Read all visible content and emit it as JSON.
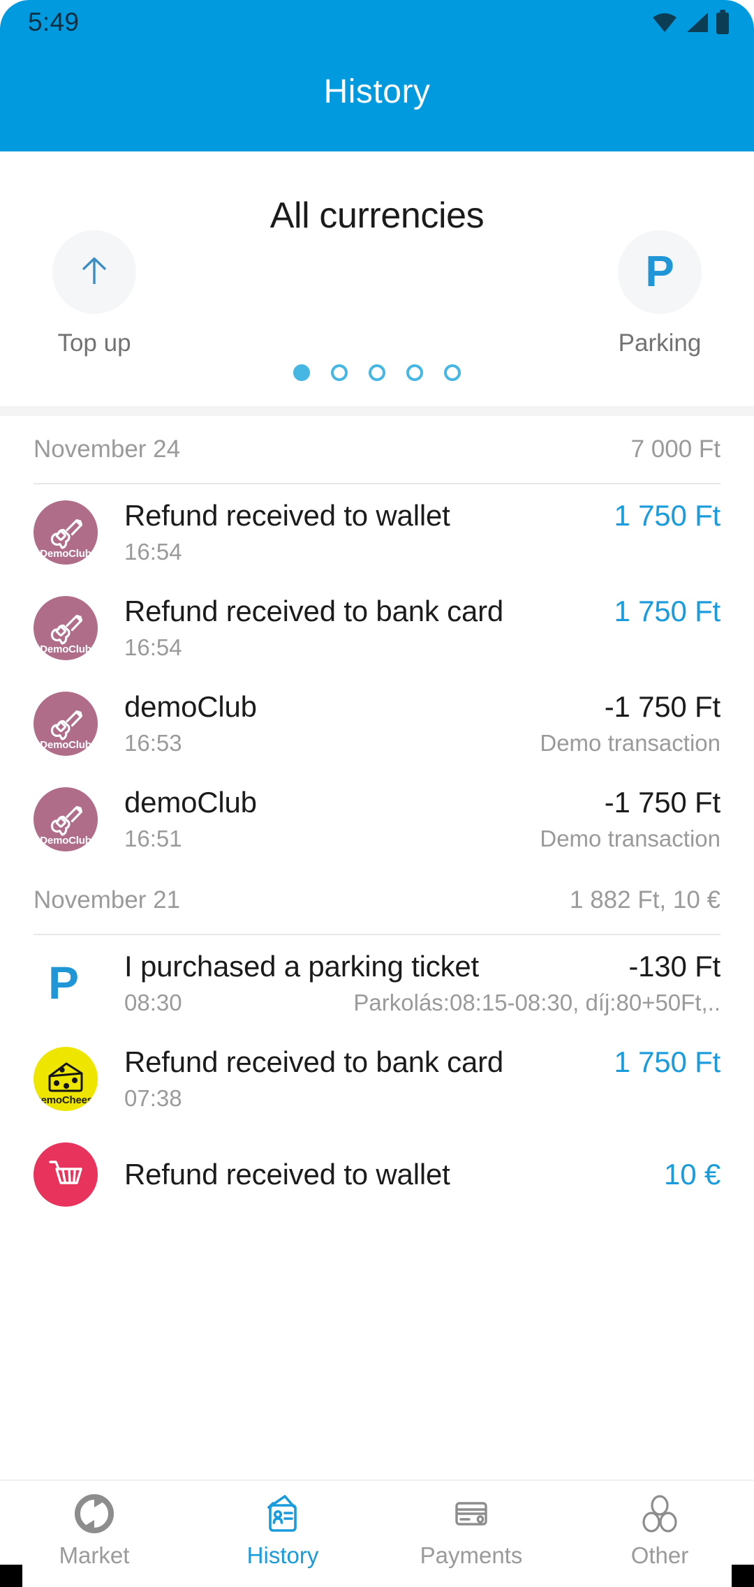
{
  "statusbar": {
    "time": "5:49",
    "icons": [
      "wifi-icon",
      "cellular-signal-icon",
      "battery-icon"
    ]
  },
  "appbar": {
    "title": "History",
    "background": "#019ADE"
  },
  "wallet_card": {
    "title": "All currencies",
    "actions": [
      {
        "label": "Top up",
        "icon": "arrow-up-icon"
      },
      {
        "label": "Parking",
        "icon": "parking-p-icon",
        "glyph": "P"
      }
    ],
    "pagination": {
      "count": 5,
      "active_index": 0,
      "color": "#46b6e3"
    }
  },
  "groups": [
    {
      "date": "November 24",
      "total": "7 000 Ft",
      "transactions": [
        {
          "avatar": {
            "kind": "club",
            "name": "DemoClub",
            "icon": "guitar-icon",
            "color": "#b06d8a"
          },
          "title": "Refund received to wallet",
          "time": "16:54",
          "amount": "1 750 Ft",
          "amount_sign": "pos",
          "note": ""
        },
        {
          "avatar": {
            "kind": "club",
            "name": "DemoClub",
            "icon": "guitar-icon",
            "color": "#b06d8a"
          },
          "title": "Refund received to bank card",
          "time": "16:54",
          "amount": "1 750 Ft",
          "amount_sign": "pos",
          "note": ""
        },
        {
          "avatar": {
            "kind": "club",
            "name": "DemoClub",
            "icon": "guitar-icon",
            "color": "#b06d8a"
          },
          "title": "demoClub",
          "time": "16:53",
          "amount": "-1 750 Ft",
          "amount_sign": "neg",
          "note": "Demo transaction"
        },
        {
          "avatar": {
            "kind": "club",
            "name": "DemoClub",
            "icon": "guitar-icon",
            "color": "#b06d8a"
          },
          "title": "demoClub",
          "time": "16:51",
          "amount": "-1 750 Ft",
          "amount_sign": "neg",
          "note": "Demo transaction"
        }
      ]
    },
    {
      "date": "November 21",
      "total": "1 882 Ft, 10 €",
      "transactions": [
        {
          "avatar": {
            "kind": "plain",
            "name": "",
            "icon": "parking-p-icon",
            "color": "#2196d6"
          },
          "title": "I purchased a parking ticket",
          "time": "08:30",
          "amount": "-130 Ft",
          "amount_sign": "neg",
          "note": "Parkolás:08:15-08:30, díj:80+50Ft,.."
        },
        {
          "avatar": {
            "kind": "cheese",
            "name": "DemoCheese",
            "icon": "cheese-icon",
            "color": "#eee600"
          },
          "title": "Refund received to bank card",
          "time": "07:38",
          "amount": "1 750 Ft",
          "amount_sign": "pos",
          "note": ""
        },
        {
          "avatar": {
            "kind": "cart",
            "name": "",
            "icon": "shopping-cart-icon",
            "color": "#e8345c"
          },
          "title": "Refund received to wallet",
          "time": "",
          "amount": "10 €",
          "amount_sign": "pos",
          "note": ""
        }
      ]
    }
  ],
  "bottomnav": {
    "active_index": 1,
    "active_color": "#1a9bdc",
    "items": [
      {
        "label": "Market",
        "icon": "sync-circle-icon"
      },
      {
        "label": "History",
        "icon": "id-card-icon"
      },
      {
        "label": "Payments",
        "icon": "credit-card-icon"
      },
      {
        "label": "Other",
        "icon": "three-circles-icon"
      }
    ]
  }
}
